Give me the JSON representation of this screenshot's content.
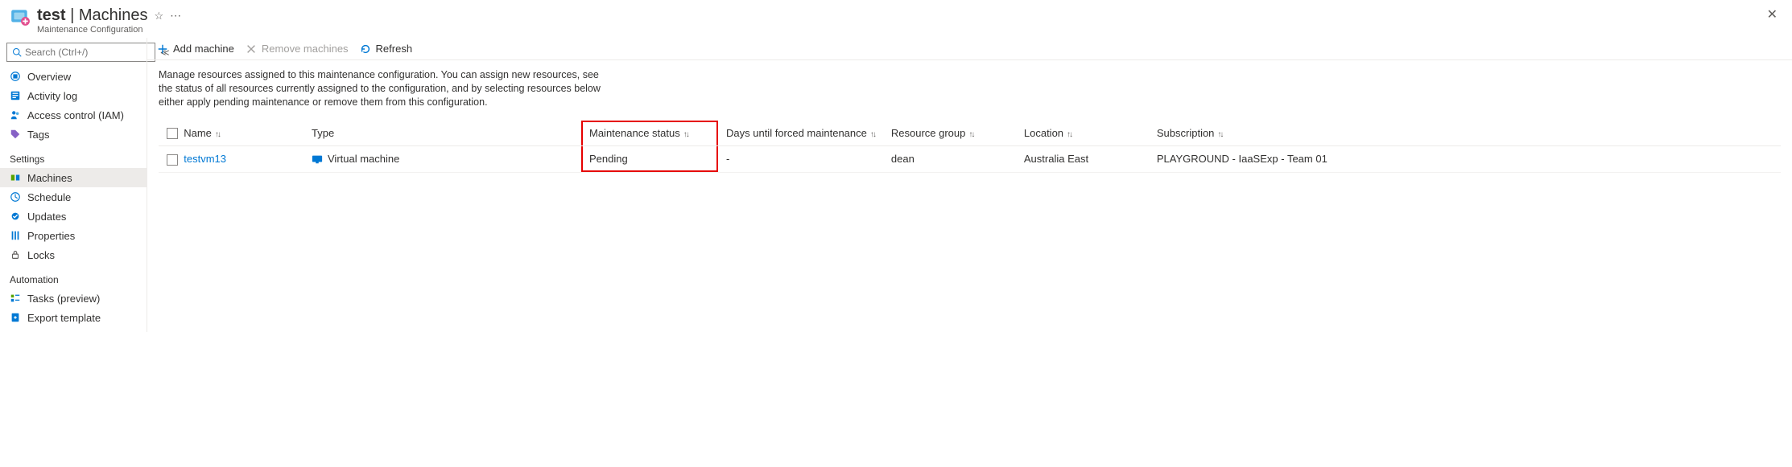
{
  "header": {
    "title_prefix": "test",
    "title_sep": " | ",
    "title_suffix": "Machines",
    "subtitle": "Maintenance Configuration"
  },
  "search": {
    "placeholder": "Search (Ctrl+/)"
  },
  "nav": {
    "overview": "Overview",
    "activity": "Activity log",
    "iam": "Access control (IAM)",
    "tags": "Tags",
    "group_settings": "Settings",
    "machines": "Machines",
    "schedule": "Schedule",
    "updates": "Updates",
    "properties": "Properties",
    "locks": "Locks",
    "group_automation": "Automation",
    "tasks": "Tasks (preview)",
    "export": "Export template"
  },
  "toolbar": {
    "add": "Add machine",
    "remove": "Remove machines",
    "refresh": "Refresh"
  },
  "description": "Manage resources assigned to this maintenance configuration. You can assign new resources, see the status of all resources currently assigned to the configuration, and by selecting resources below either apply pending maintenance or remove them from this configuration.",
  "columns": {
    "name": "Name",
    "type": "Type",
    "status": "Maintenance status",
    "days": "Days until forced maintenance",
    "rg": "Resource group",
    "loc": "Location",
    "sub": "Subscription"
  },
  "rows": [
    {
      "name": "testvm13",
      "type": "Virtual machine",
      "status": "Pending",
      "days": "-",
      "rg": "dean",
      "loc": "Australia East",
      "sub": "PLAYGROUND - IaaSExp - Team 01"
    }
  ]
}
